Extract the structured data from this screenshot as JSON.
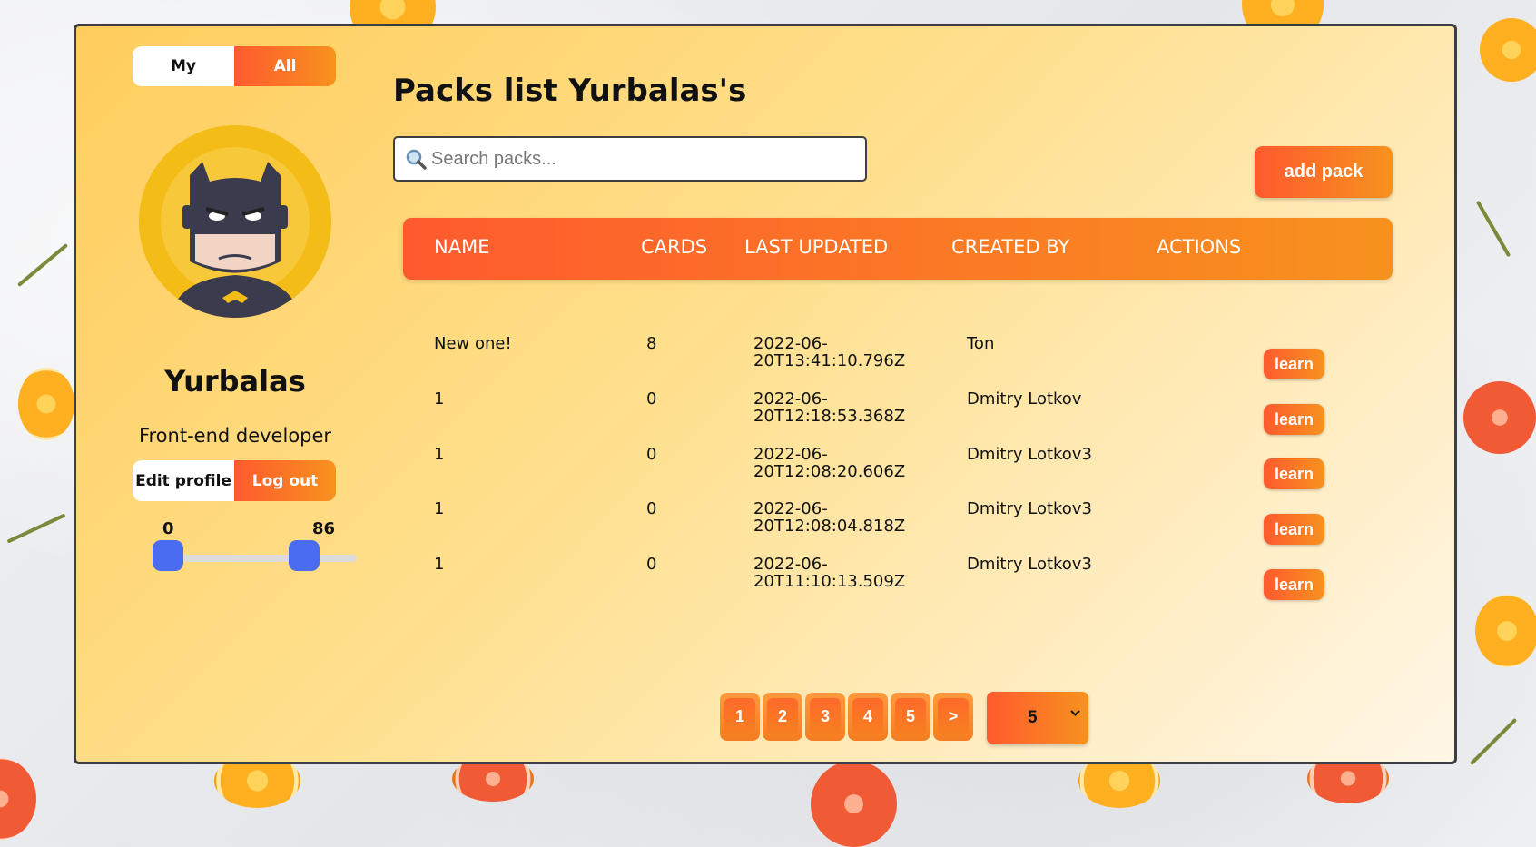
{
  "toggle": {
    "my_label": "My",
    "all_label": "All"
  },
  "profile": {
    "name": "Yurbalas",
    "subtitle": "Front-end developer",
    "edit_label": "Edit profile",
    "logout_label": "Log out"
  },
  "slider": {
    "min_value": "0",
    "max_value": "86"
  },
  "main": {
    "title": "Packs list Yurbalas's",
    "search_placeholder": "Search packs...",
    "add_pack_label": "add pack"
  },
  "table": {
    "headers": [
      "NAME",
      "CARDS",
      "LAST UPDATED",
      "CREATED BY",
      "ACTIONS"
    ],
    "rows": [
      {
        "name": "New one!",
        "cards": "8",
        "updated": "2022-06-20T13:41:10.796Z",
        "created_by": "Ton",
        "action": "learn"
      },
      {
        "name": "1",
        "cards": "0",
        "updated": "2022-06-20T12:18:53.368Z",
        "created_by": "Dmitry Lotkov",
        "action": "learn"
      },
      {
        "name": "1",
        "cards": "0",
        "updated": "2022-06-20T12:08:20.606Z",
        "created_by": "Dmitry Lotkov3",
        "action": "learn"
      },
      {
        "name": "1",
        "cards": "0",
        "updated": "2022-06-20T12:08:04.818Z",
        "created_by": "Dmitry Lotkov3",
        "action": "learn"
      },
      {
        "name": "1",
        "cards": "0",
        "updated": "2022-06-20T11:10:13.509Z",
        "created_by": "Dmitry Lotkov3",
        "action": "learn"
      }
    ]
  },
  "pagination": {
    "pages": [
      "1",
      "2",
      "3",
      "4",
      "5"
    ],
    "next_label": ">",
    "per_page_value": "5"
  },
  "icons": {
    "search": "search-icon",
    "dropdown": "chevron-down-icon",
    "avatar": "batman-avatar"
  },
  "colors": {
    "accent_start": "#ff5a2e",
    "accent_end": "#f7921e",
    "slider_handle": "#4a6cf0",
    "panel_bg": "#ffd679"
  }
}
